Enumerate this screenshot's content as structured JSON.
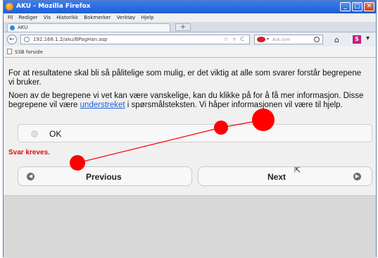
{
  "window": {
    "title": "AKU - Mozilla Firefox",
    "controls": {
      "minimize": "_",
      "maximize": "□",
      "close": "✕"
    }
  },
  "menubar": {
    "items": [
      "Fil",
      "Rediger",
      "Vis",
      "Historikk",
      "Bokmerker",
      "Verktøy",
      "Hjelp"
    ]
  },
  "tabs": [
    {
      "label": "AKU"
    }
  ],
  "new_tab_label": "+",
  "navbar": {
    "back_icon": "←",
    "url": "192.168.1.2/aku/BPagHan.asp",
    "url_controls": "☆ ▿ C",
    "search_arrow": "▾",
    "search_placeholder": "Ask.com",
    "home_icon": "⌂",
    "s_icon": "S",
    "more_icon": "▾"
  },
  "bookmarks": {
    "items": [
      {
        "label": "SSB forside"
      }
    ]
  },
  "main": {
    "intro_text": "For at resultatene skal bli så pålitelige som mulig, er det viktig at alle som svarer forstår begrepene vi bruker.",
    "info_line1": "Noen av de begrepene vi vet kan være vanskelige, kan du klikke på for å få mer informasjon. Disse begrepene vil være ",
    "info_link": "understreket",
    "info_line2": " i spørsmålsteksten. Vi håper informasjonen vil være til hjelp.",
    "ok_option": "OK",
    "error_text": "Svar kreves.",
    "prev_label": "Previous",
    "next_label": "Next",
    "prev_icon": "◀",
    "next_icon": "▶"
  },
  "annotation": {
    "color": "#ff0000"
  },
  "cursor_icon": "⇱"
}
